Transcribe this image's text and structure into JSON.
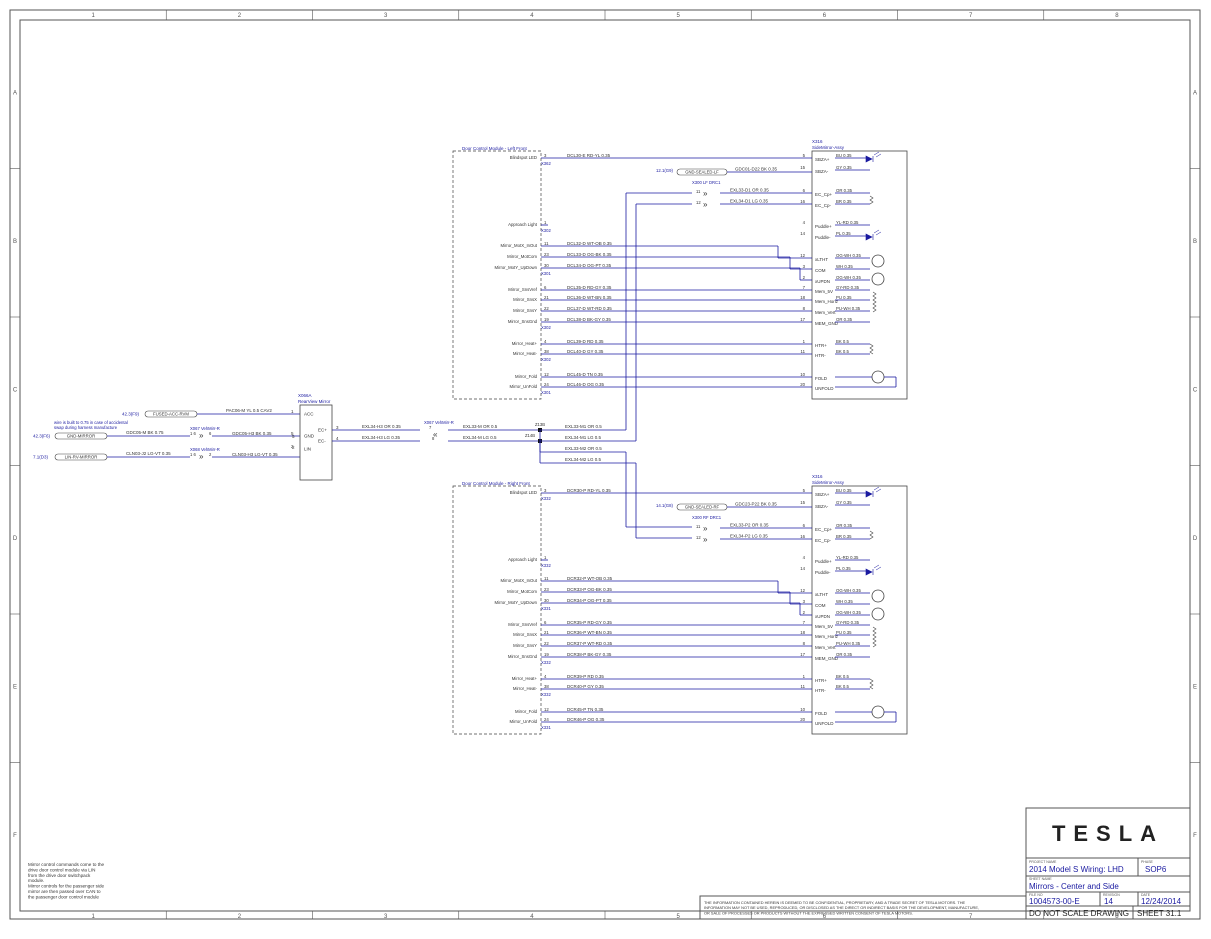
{
  "grid": {
    "columns": [
      "1",
      "2",
      "3",
      "4",
      "5",
      "6",
      "7",
      "8"
    ],
    "rows": [
      "A",
      "B",
      "C",
      "D",
      "E",
      "F"
    ]
  },
  "colors": {
    "frame": "#555555",
    "wire": "#1a1aa0",
    "text": "#333333",
    "blue": "#2233aa",
    "box": "#444444"
  },
  "notes": {
    "left_lines": [
      "Mirror control commands come to the",
      "drive door control module via LIN",
      "from the drive door switchpack",
      "module.",
      "Mirror controls for the passenger side",
      "mirror are then passed over CAN to",
      "the passenger door control module"
    ]
  },
  "rearview_mirror": {
    "id": "X066A",
    "name": "RearView Mirror",
    "pins": [
      "ACC",
      "GND",
      "LIN",
      "EC+",
      "EC-"
    ],
    "pin_numbers": [
      "1",
      "5",
      "2",
      "3",
      "4"
    ]
  },
  "left_inputs": {
    "wire_note": [
      "wire is built to 0.75 in case of accidental",
      "swap during harness manufacture"
    ],
    "wires": [
      {
        "ref": "42.3(F9)",
        "net": "FUSED-ACC-RVM",
        "label": "PAC06-M YL 0.5 CAV2"
      },
      {
        "ref": "42.3(F6)",
        "net": "GND-MIRROR",
        "label": "GDC05-M BK 0.75"
      },
      {
        "ref": "7.1(D3)",
        "net": "LIN-RV-MIRROR",
        "label": "CLN03-J2 LG-VT 0.35"
      }
    ],
    "connectors": [
      {
        "id": "X067 VehMirr-R",
        "pins": [
          "1 6",
          "6"
        ],
        "wire": "GDC05-H3 BK 0.35"
      },
      {
        "id": "X068 VehMirr-R",
        "pins": [
          "1 6",
          "2"
        ],
        "wire": "CLN03-H3 LG-VT 0.35"
      }
    ],
    "ec_wires": [
      "EXL34-H3 OR 0.35",
      "EXL34-H3 LG 0.35"
    ],
    "inline_connector": "X067 VehMirr-R",
    "inline_pins": [
      "7",
      "8"
    ],
    "ec_wires_out": [
      "EXL33-M OR 0.5",
      "EXL34-M LG 0.5"
    ],
    "splices": [
      "Z13B",
      "Z14B"
    ],
    "branch_wires": [
      "EXL33-M1 OR 0.5",
      "EXL34-M1 LG 0.5",
      "EXL33-M2 OR 0.5",
      "EXL34-M2 LG 0.5"
    ]
  },
  "doors": [
    {
      "title": "Door Control Module - Left Front",
      "mirror_id": "X316",
      "mirror_name": "SideMirror-Assy",
      "blindspot_label": "Blindspot LED",
      "pins": [
        {
          "name": "Blindspot LED",
          "pin": "3",
          "wire": "DCL30-E RD-YL 0.35"
        },
        {
          "name": "Approach Light",
          "pin": "1",
          "wire": ""
        },
        {
          "name": "Mirror_MotX_InOut",
          "pin": "11",
          "wire": "DCL32-D WT-OB 0.35"
        },
        {
          "name": "Mirror_MotCom",
          "pin": "23",
          "wire": "DCL33-D OG-BK 0.35"
        },
        {
          "name": "Mirror_MotY_UpDown",
          "pin": "30",
          "wire": "DCL34-D OG-PT 0.35"
        },
        {
          "name": "Mirror_SnsVref",
          "pin": "6",
          "wire": "DCL35-D RD-GY 0.35"
        },
        {
          "name": "Mirror_SnsX",
          "pin": "21",
          "wire": "DCL36-D WT-BN 0.35"
        },
        {
          "name": "Mirror_SnsY",
          "pin": "22",
          "wire": "DCL37-D WT-RD 0.35"
        },
        {
          "name": "Mirror_SnsGnd",
          "pin": "19",
          "wire": "DCL38-D BK-GY 0.35"
        },
        {
          "name": "Mirror_Heat+",
          "pin": "4",
          "wire": "DCL39-D RD 0.35"
        },
        {
          "name": "Mirror_Heat-",
          "pin": "38",
          "wire": "DCL40-D GY 0.35"
        },
        {
          "name": "Mirror_Fold",
          "pin": "12",
          "wire": "DCL45-D TN 0.35"
        },
        {
          "name": "Mirror_UnFold",
          "pin": "24",
          "wire": "DCL46-D OG 0.35"
        }
      ],
      "sub_connectors": [
        "X362",
        "X302",
        "X301",
        "X302",
        "X302",
        "X301"
      ],
      "ground_ref": "12.1(G9)",
      "ground_net": "GND-SEALED-LF",
      "ground_wire": "GDC01-D22 BK 0.35",
      "ec_conn": "X300 LF DRC1",
      "ec_wires": [
        "EXL33-D1 OR 0.35",
        "EXL34-D1 LG 0.35"
      ],
      "ec_pins": [
        "11",
        "12"
      ],
      "mirror_pins": [
        {
          "name": "SBZA+",
          "pin": "5",
          "wire": "BU 0.35"
        },
        {
          "name": "SBZA-",
          "pin": "15",
          "wire": "GY 0.35"
        },
        {
          "name": "EC_Cp+",
          "pin": "6",
          "wire": "OR 0.35"
        },
        {
          "name": "EC_Cp-",
          "pin": "16",
          "wire": "BR 0.35"
        },
        {
          "name": "Puddle+",
          "pin": "4",
          "wire": "YL-RD 0.35"
        },
        {
          "name": "Puddle-",
          "pin": "14",
          "wire": "PL 0.35"
        },
        {
          "name": "xLTHT",
          "pin": "12",
          "wire": "OG-WH 0.35"
        },
        {
          "name": "COM",
          "pin": "3",
          "wire": "WH 0.35"
        },
        {
          "name": "xUPDN",
          "pin": "2",
          "wire": "OG-WH 0.35"
        },
        {
          "name": "Mem_5V",
          "pin": "7",
          "wire": "GY-RD 0.35"
        },
        {
          "name": "Mem_Horiz",
          "pin": "18",
          "wire": "PU 0.35"
        },
        {
          "name": "Mem_Vert",
          "pin": "8",
          "wire": "PU-WH 0.35"
        },
        {
          "name": "MEM_GND",
          "pin": "17",
          "wire": "OR 0.35"
        },
        {
          "name": "HTR+",
          "pin": "1",
          "wire": "BK 0.5"
        },
        {
          "name": "HTR-",
          "pin": "11",
          "wire": "BK 0.5"
        },
        {
          "name": "FOLD",
          "pin": "10",
          "wire": ""
        },
        {
          "name": "UNFOLD",
          "pin": "20",
          "wire": ""
        }
      ]
    },
    {
      "title": "Door Control Module - Right Front",
      "mirror_id": "X316",
      "mirror_name": "SideMirror-Assy",
      "blindspot_label": "Blindspot LED",
      "pins": [
        {
          "name": "Blindspot LED",
          "pin": "3",
          "wire": "DCR30-P RD-YL 0.35"
        },
        {
          "name": "Approach Light",
          "pin": "1",
          "wire": ""
        },
        {
          "name": "Mirror_MotX_InOut",
          "pin": "11",
          "wire": "DCR32-P WT-OB 0.35"
        },
        {
          "name": "Mirror_MotCom",
          "pin": "23",
          "wire": "DCR33-P OG-BK 0.35"
        },
        {
          "name": "Mirror_MotY_UpDown",
          "pin": "30",
          "wire": "DCR34-P OG-PT 0.35"
        },
        {
          "name": "Mirror_SnsVref",
          "pin": "6",
          "wire": "DCR35-P RD-GY 0.35"
        },
        {
          "name": "Mirror_SnsX",
          "pin": "21",
          "wire": "DCR36-P WT-BN 0.35"
        },
        {
          "name": "Mirror_SnsY",
          "pin": "22",
          "wire": "DCR37-P WT-RD 0.35"
        },
        {
          "name": "Mirror_SnsGnd",
          "pin": "19",
          "wire": "DCR38-P BK-GY 0.35"
        },
        {
          "name": "Mirror_Heat+",
          "pin": "4",
          "wire": "DCR39-P RD 0.35"
        },
        {
          "name": "Mirror_Heat-",
          "pin": "38",
          "wire": "DCR40-P GY 0.35"
        },
        {
          "name": "Mirror_Fold",
          "pin": "12",
          "wire": "DCR45-P TN 0.35"
        },
        {
          "name": "Mirror_UnFold",
          "pin": "24",
          "wire": "DCR46-P OG 0.35"
        }
      ],
      "sub_connectors": [
        "X332",
        "X332",
        "X331",
        "X332",
        "X332",
        "X331"
      ],
      "ground_ref": "14.1(G8)",
      "ground_net": "GND-SEALED-RF",
      "ground_wire": "GDC23-P22 BK 0.35",
      "ec_conn": "X300 RF DRC1",
      "ec_wires": [
        "EXL33-P2 OR 0.35",
        "EXL34-P2 LG 0.35"
      ],
      "ec_pins": [
        "11",
        "12"
      ],
      "mirror_pins": [
        {
          "name": "SBZA+",
          "pin": "5",
          "wire": "BU 0.35"
        },
        {
          "name": "SBZA-",
          "pin": "15",
          "wire": "GY 0.35"
        },
        {
          "name": "EC_Cp+",
          "pin": "6",
          "wire": "OR 0.35"
        },
        {
          "name": "EC_Cp-",
          "pin": "16",
          "wire": "BR 0.35"
        },
        {
          "name": "Puddle+",
          "pin": "4",
          "wire": "YL-RD 0.35"
        },
        {
          "name": "Puddle-",
          "pin": "14",
          "wire": "PL 0.35"
        },
        {
          "name": "xLTHT",
          "pin": "12",
          "wire": "OG-WH 0.35"
        },
        {
          "name": "COM",
          "pin": "3",
          "wire": "WH 0.35"
        },
        {
          "name": "xUPDN",
          "pin": "2",
          "wire": "OG-WH 0.35"
        },
        {
          "name": "Mem_5V",
          "pin": "7",
          "wire": "GY-RD 0.35"
        },
        {
          "name": "Mem_Horiz",
          "pin": "18",
          "wire": "PU 0.35"
        },
        {
          "name": "Mem_Vert",
          "pin": "8",
          "wire": "PU-WH 0.35"
        },
        {
          "name": "MEM_GND",
          "pin": "17",
          "wire": "OR 0.35"
        },
        {
          "name": "HTR+",
          "pin": "1",
          "wire": "BK 0.5"
        },
        {
          "name": "HTR-",
          "pin": "11",
          "wire": "BK 0.5"
        },
        {
          "name": "FOLD",
          "pin": "10",
          "wire": ""
        },
        {
          "name": "UNFOLD",
          "pin": "20",
          "wire": ""
        }
      ]
    }
  ],
  "confidential": [
    "THE INFORMATION CONTAINED HEREIN IS DEEMED TO BE CONFIDENTIAL, PROPRIETARY, AND A TRADE SECRET OF TESLA MOTORS. THE",
    "INFORMATION MAY NOT BE USED, REPRODUCED, OR DISCLOSED AS THE DIRECT OR INDIRECT BASIS FOR THE DEVELOPMENT, MANUFACTURE,",
    "OR SALE OF PROCESSES OR PRODUCTS WITHOUT THE EXPRESSED WRITTEN CONSENT OF TESLA MOTORS."
  ],
  "title_block": {
    "logo": "TESLA",
    "project_label": "PROJECT NAME",
    "project": "2014 Model S Wiring: LHD",
    "phase_label": "PHASE",
    "phase": "SOP6",
    "sheet_name_label": "SHEET NAME",
    "sheet_name": "Mirrors - Center and Side",
    "file_label": "FILE NO",
    "file_no": "1004573-00-E",
    "revision_label": "REVISION",
    "revision": "14",
    "date_label": "DATE",
    "date": "12/24/2014",
    "no_scale": "DO NOT SCALE DRAWING",
    "sheet": "SHEET 31.1"
  }
}
